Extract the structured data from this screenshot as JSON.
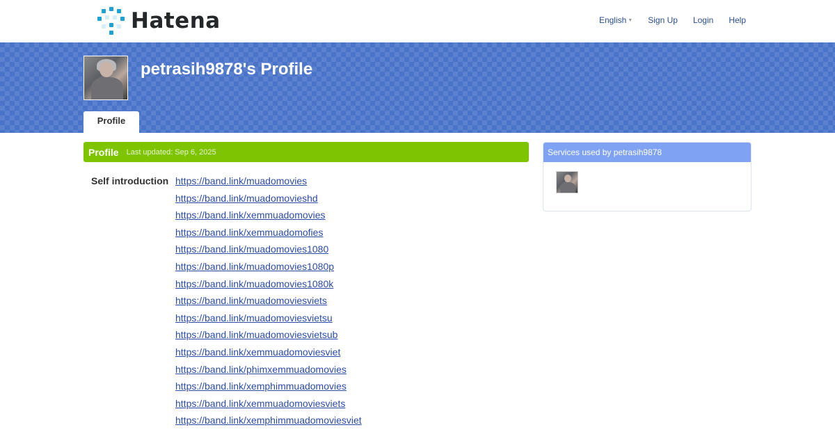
{
  "header": {
    "logo_text": "Hatena",
    "nav": {
      "language": "English",
      "sign_up": "Sign Up",
      "login": "Login",
      "help": "Help"
    }
  },
  "banner": {
    "title": "petrasih9878's Profile",
    "tab_label": "Profile"
  },
  "profile": {
    "section_title": "Profile",
    "last_updated": "Last updated: Sep 6, 2025",
    "intro_label": "Self introduction",
    "links": [
      "https://band.link/muadomovies",
      "https://band.link/muadomovieshd",
      "https://band.link/xemmuadomovies",
      "https://band.link/xemmuadomofies",
      "https://band.link/muadomovies1080",
      "https://band.link/muadomovies1080p",
      "https://band.link/muadomovies1080k",
      "https://band.link/muadomoviesviets",
      "https://band.link/muadomoviesvietsu",
      "https://band.link/muadomoviesvietsub",
      "https://band.link/xemmuadomoviesviet",
      "https://band.link/phimxemmuadomovies",
      "https://band.link/xemphimmuadomovies",
      "https://band.link/xemmuadomoviesviets",
      "https://band.link/xemphimmuadomoviesviet"
    ]
  },
  "sidebar": {
    "services_title": "Services used by petrasih9878"
  },
  "colors": {
    "banner_blue": "#4a74c9",
    "section_green": "#7fc400",
    "services_header_blue": "#7fa2f2",
    "link_blue": "#2c4ca8",
    "logo_cyan": "#1aa3d4"
  },
  "icons": {
    "logo": "hatena-dots-logo-icon",
    "language_caret": "caret-down-icon"
  }
}
